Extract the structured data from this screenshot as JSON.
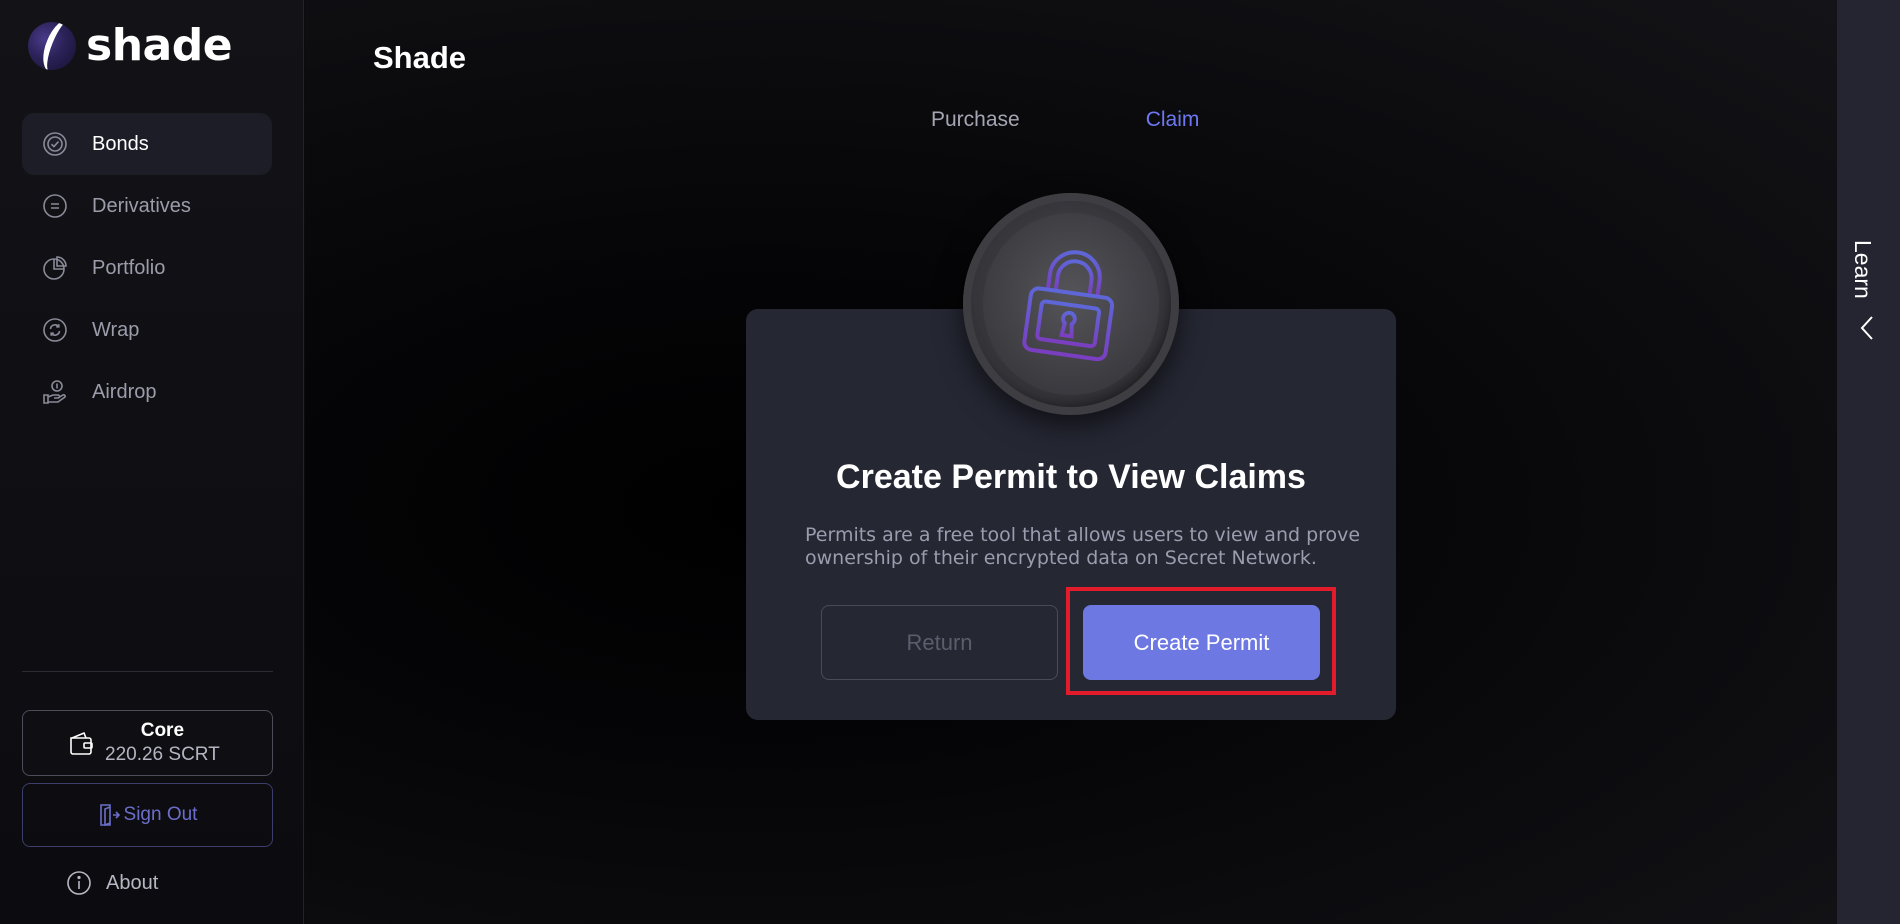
{
  "app": {
    "logo_text": "shade",
    "page_title": "Shade"
  },
  "sidebar": {
    "items": [
      {
        "label": "Bonds",
        "icon": "bonds-icon",
        "active": true
      },
      {
        "label": "Derivatives",
        "icon": "derivatives-icon",
        "active": false
      },
      {
        "label": "Portfolio",
        "icon": "portfolio-icon",
        "active": false
      },
      {
        "label": "Wrap",
        "icon": "wrap-icon",
        "active": false
      },
      {
        "label": "Airdrop",
        "icon": "airdrop-icon",
        "active": false
      }
    ],
    "wallet": {
      "name": "Core",
      "balance": "220.26 SCRT",
      "icon": "wallet-icon"
    },
    "sign_out": "Sign Out",
    "about": "About"
  },
  "tabs": [
    {
      "label": "Purchase",
      "active": false
    },
    {
      "label": "Claim",
      "active": true
    }
  ],
  "card": {
    "icon": "lock-icon",
    "title": "Create Permit to View Claims",
    "description": "Permits are a free tool that allows users to view and prove ownership of their encrypted data on Secret Network.",
    "return_label": "Return",
    "create_label": "Create Permit"
  },
  "learn": {
    "label": "Learn"
  },
  "colors": {
    "accent": "#6d78e3",
    "active_tab": "#6d78f0",
    "highlight": "#e21c2b",
    "card_bg": "#252733"
  }
}
